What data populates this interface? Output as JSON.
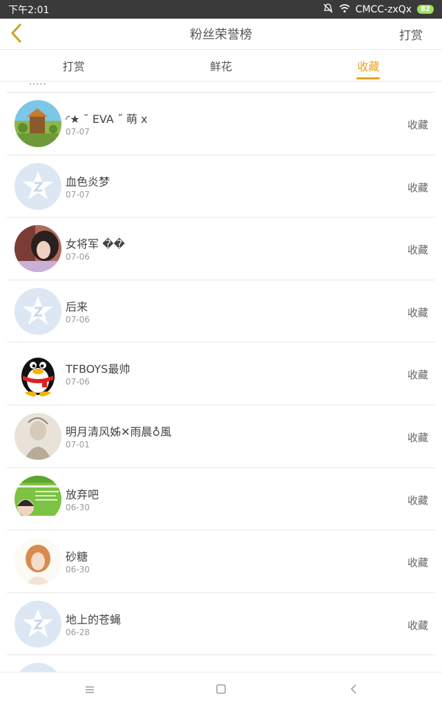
{
  "status": {
    "time": "下午2:01",
    "carrier": "CMCC-zxQx",
    "battery": "82"
  },
  "header": {
    "title": "粉丝荣誉榜",
    "reward_label": "打赏"
  },
  "tabs": [
    {
      "label": "打赏",
      "active": false
    },
    {
      "label": "鲜花",
      "active": false
    },
    {
      "label": "收藏",
      "active": true
    }
  ],
  "partial_top_text": "•••••",
  "fans": [
    {
      "name": "◜★ ˘ EVA ˝ 萌 x",
      "date": "07-07",
      "kind": "收藏",
      "avatar": "landscape"
    },
    {
      "name": "血色炎梦",
      "date": "07-07",
      "kind": "收藏",
      "avatar": "default-qq"
    },
    {
      "name": "女将军 ��",
      "date": "07-06",
      "kind": "收藏",
      "avatar": "girl-photo"
    },
    {
      "name": "后来",
      "date": "07-06",
      "kind": "收藏",
      "avatar": "default-qq"
    },
    {
      "name": "TFBOYS最帅",
      "date": "07-06",
      "kind": "收藏",
      "avatar": "penguin"
    },
    {
      "name": "明月清风姊✕雨晨♁風",
      "date": "07-01",
      "kind": "收藏",
      "avatar": "sketch"
    },
    {
      "name": "放弃吧",
      "date": "06-30",
      "kind": "收藏",
      "avatar": "green-poster"
    },
    {
      "name": "砂糖",
      "date": "06-30",
      "kind": "收藏",
      "avatar": "portrait"
    },
    {
      "name": "地上的苍蝇",
      "date": "06-28",
      "kind": "收藏",
      "avatar": "default-qq"
    }
  ],
  "colors": {
    "accent": "#f0a020",
    "status_bar": "#3a3a3a",
    "default_avatar": "#dde7f4"
  },
  "icons": {
    "back": "chevron-left-icon",
    "menu": "menu-icon",
    "home": "home-icon",
    "nav_back": "back-icon"
  }
}
